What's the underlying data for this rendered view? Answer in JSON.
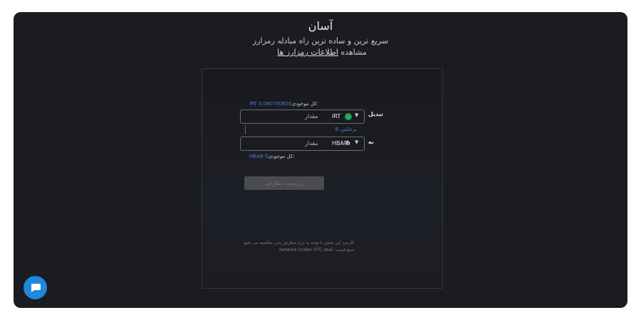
{
  "header": {
    "title": "آسان",
    "subtitle": "سریع ترین و ساده ترین راه مبادله رمزارز",
    "info_prefix": "مشاهده",
    "info_link": "اطلاعات رمزارز ها"
  },
  "swap": {
    "from_label": "تبدیل",
    "to_label": "به",
    "from_balance_label": "کل موجودی:",
    "from_balance_value": "IRT 0.060700650",
    "to_balance_label": "کل موجودی:",
    "to_balance_value": "HBAR 0",
    "from_coin": "IRT",
    "to_coin": "HBAR",
    "from_amount_placeholder": "مقدار",
    "to_amount_placeholder": "مقدار",
    "reverse_label": "⇅ برعکس",
    "submit_label": "بررسی سفارش"
  },
  "notes": {
    "fee_line": "کارمزد این بخش با توجه به نرخ سفارش پذیر محاسبه می شود",
    "price_source": "منبع قیمت: Network broker OTC deal"
  },
  "icons": {
    "from_coin_icon": "irt-coin-icon",
    "to_coin_icon": "hbar-coin-icon",
    "chat": "chat-bubble-icon"
  },
  "colors": {
    "background": "#1b1c21",
    "accent": "#4e7ad8",
    "chat": "#1e88dc"
  }
}
